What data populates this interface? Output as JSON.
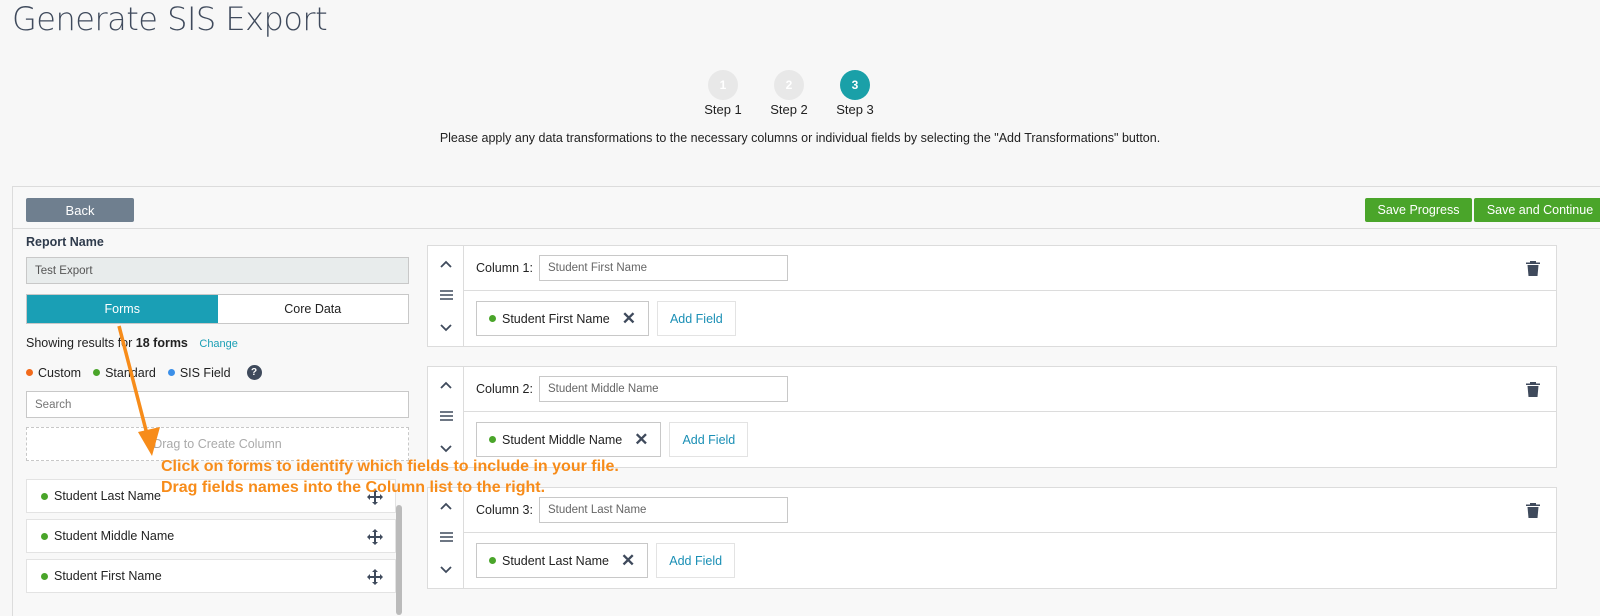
{
  "page": {
    "title": "Generate SIS Export"
  },
  "stepper": {
    "steps": [
      {
        "number": "1",
        "label": "Step 1"
      },
      {
        "number": "2",
        "label": "Step 2"
      },
      {
        "number": "3",
        "label": "Step 3"
      }
    ],
    "active_step": 3
  },
  "instructions": "Please apply any data transformations to the necessary columns or individual fields by selecting the \"Add Transformations\" button.",
  "toolbar": {
    "back_label": "Back",
    "save_progress_label": "Save Progress",
    "save_continue_label": "Save and Continue"
  },
  "left_panel": {
    "report_name_label": "Report Name",
    "report_name_value": "Test Export",
    "tabs": [
      "Forms",
      "Core Data"
    ],
    "active_tab": "Forms",
    "results_prefix": "Showing results for ",
    "results_count": "18 forms",
    "change_label": "Change",
    "legend": [
      {
        "label": "Custom",
        "color": "#f26a1b"
      },
      {
        "label": "Standard",
        "color": "#4aa52a"
      },
      {
        "label": "SIS Field",
        "color": "#3b8fe8"
      }
    ],
    "help_glyph": "?",
    "search_placeholder": "Search",
    "drag_zone_label": "Drag to Create Column",
    "fields": [
      {
        "label": "Student Last Name",
        "color": "#4aa52a"
      },
      {
        "label": "Student Middle Name",
        "color": "#4aa52a"
      },
      {
        "label": "Student First Name",
        "color": "#4aa52a"
      }
    ]
  },
  "columns": [
    {
      "label": "Column 1:",
      "value": "Student First Name",
      "field": "Student First Name",
      "add_label": "Add Field"
    },
    {
      "label": "Column 2:",
      "value": "Student Middle Name",
      "field": "Student Middle Name",
      "add_label": "Add Field"
    },
    {
      "label": "Column 3:",
      "value": "Student Last Name",
      "field": "Student Last Name",
      "add_label": "Add Field"
    }
  ],
  "annotation": {
    "line1": "Click on forms to identify which fields to include in your file.",
    "line2": "Drag fields names into the Column list to the right."
  },
  "colors": {
    "accent": "#1a9fb5",
    "save_green": "#4aa52a",
    "annotation_orange": "#f78c1a"
  },
  "icons": {
    "field_move": "move-icon",
    "column_up": "chevron-up-icon",
    "column_drag": "drag-handle-icon",
    "column_down": "chevron-down-icon",
    "column_delete": "trash-icon",
    "remove_field": "close-icon"
  }
}
